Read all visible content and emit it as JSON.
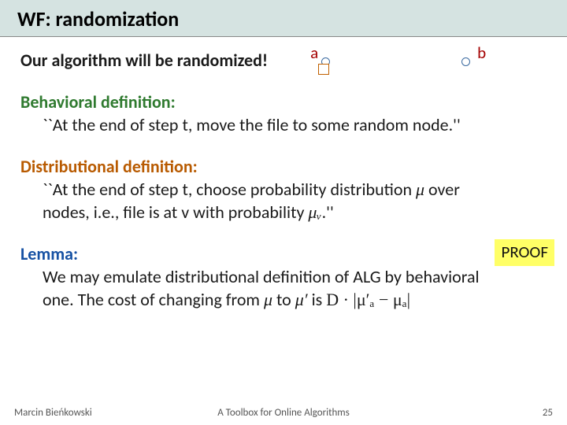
{
  "title": "WF: randomization",
  "intro": "Our algorithm will be randomized!",
  "graph": {
    "a": "a",
    "b": "b"
  },
  "behavioral": {
    "heading": "Behavioral definition:",
    "text": "``At the end of step t, move the file to some random node.''"
  },
  "distributional": {
    "heading": "Distributional definition:",
    "line1_pre": "``At the end of step t, choose probability distribution ",
    "mu": "μ",
    "line1_post": " over",
    "line2_pre": "nodes, i.e., file is at v with probability ",
    "mu_v": "μᵥ",
    "line2_post": ".''"
  },
  "lemma": {
    "heading": "Lemma:",
    "proof_label": "PROOF",
    "line1": "We may emulate distributional definition of ALG by behavioral",
    "line2_pre": " one. The cost of changing from ",
    "mu1": "μ",
    "line2_mid": " to ",
    "mu2": "μ′",
    "line2_post": " is ",
    "formula": "D · |μ′ₐ − μₐ|"
  },
  "footer": {
    "author": "Marcin Bieńkowski",
    "center": "A Toolbox for Online Algorithms",
    "page": "25"
  }
}
